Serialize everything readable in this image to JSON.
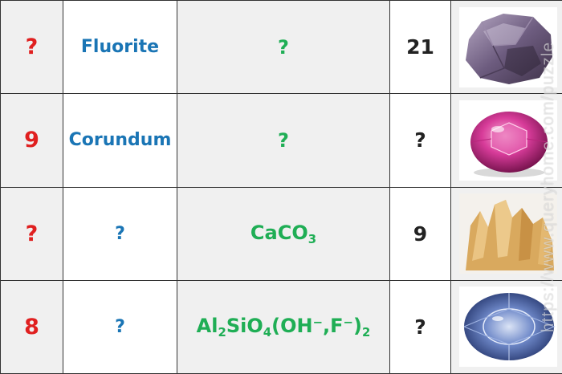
{
  "rows": [
    {
      "hardness": "?",
      "name": "Fluorite",
      "formula": {
        "type": "text",
        "text": "?"
      },
      "specific_gravity": "21",
      "image_icon": "purple-fluorite-crystal"
    },
    {
      "hardness": "9",
      "name": "Corundum",
      "formula": {
        "type": "text",
        "text": "?"
      },
      "specific_gravity": "?",
      "image_icon": "pink-faceted-gem"
    },
    {
      "hardness": "?",
      "name": "?",
      "formula": {
        "type": "chem",
        "parts": [
          "CaCO",
          "3"
        ]
      },
      "specific_gravity": "9",
      "image_icon": "amber-calcite-crystal"
    },
    {
      "hardness": "8",
      "name": "?",
      "formula": {
        "type": "chem",
        "parts": [
          "Al",
          "2",
          "SiO",
          "4",
          "(OH",
          "−",
          ",F",
          "−",
          ")",
          "2"
        ]
      },
      "specific_gravity": "?",
      "image_icon": "blue-faceted-gem"
    }
  ],
  "watermark": "https://www.queryhome.com/puzzle",
  "colors": {
    "hardness": "#e02020",
    "name": "#1a75b5",
    "formula": "#1fae55",
    "specific_gravity": "#222222",
    "cell_gray": "#f0f0f0"
  }
}
